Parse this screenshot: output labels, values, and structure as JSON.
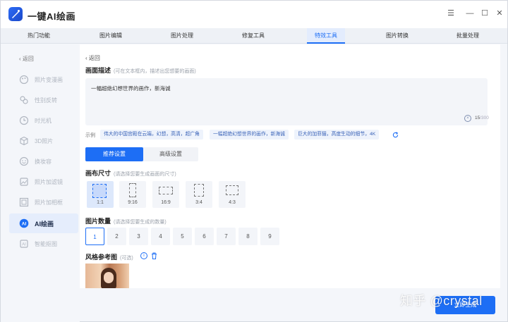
{
  "app": {
    "title": "一键AI绘画"
  },
  "window_controls": {
    "menu": "☰",
    "minimize": "—",
    "maximize": "☐",
    "close": "✕"
  },
  "tabs": [
    {
      "label": "热门功能"
    },
    {
      "label": "图片编辑"
    },
    {
      "label": "图片处理"
    },
    {
      "label": "修复工具"
    },
    {
      "label": "特效工具",
      "active": true
    },
    {
      "label": "图片转换"
    },
    {
      "label": "批量处理"
    }
  ],
  "sidebar": {
    "back_label": "返回",
    "items": [
      {
        "label": "照片变漫画",
        "icon": "palette-icon"
      },
      {
        "label": "性别反转",
        "icon": "gender-icon"
      },
      {
        "label": "时光机",
        "icon": "clock-icon"
      },
      {
        "label": "3D照片",
        "icon": "cube-icon"
      },
      {
        "label": "换妆容",
        "icon": "makeup-icon"
      },
      {
        "label": "照片加滤镜",
        "icon": "filter-icon"
      },
      {
        "label": "照片加相框",
        "icon": "frame-icon"
      },
      {
        "label": "AI绘画",
        "icon": "ai-paint-icon",
        "active": true
      },
      {
        "label": "智能抠图",
        "icon": "cutout-icon"
      }
    ]
  },
  "main": {
    "back_label": "返回",
    "description": {
      "title": "画面描述",
      "hint": "(可在文本框内，描述出您想要的画面)",
      "value": "一幅超绝幻想世界的画作，新海诚",
      "clear": "×",
      "count": "15",
      "max": "/300"
    },
    "examples": {
      "label": "示例",
      "chips": [
        "伟大的中国宫殿在云端，幻想，高清，超广角",
        "一幅超绝幻想世界的画作，新海诚",
        "巨大的加菲猫，高度生动的细节，4K"
      ]
    },
    "mode_tabs": {
      "active": "推荐设置",
      "inactive": "高级设置"
    },
    "canvas": {
      "title": "画布尺寸",
      "hint": "(请选择您要生成画面的尺寸)",
      "ratios": [
        "1:1",
        "9:16",
        "16:9",
        "3:4",
        "4:3"
      ],
      "selected": "1:1"
    },
    "quantity": {
      "title": "图片数量",
      "hint": "(请选择您要生成的数量)",
      "options": [
        "1",
        "2",
        "3",
        "4",
        "5",
        "6",
        "7",
        "8",
        "9"
      ],
      "selected": "1"
    },
    "style_ref": {
      "title": "风格参考图",
      "hint": "(可选)"
    }
  },
  "generate_button": {
    "label": "立即生成"
  },
  "watermark": "知乎 @crystal",
  "colors": {
    "accent": "#1d6ef5",
    "chip_bg": "#eef3fc",
    "active_bg": "#e5edfc"
  }
}
